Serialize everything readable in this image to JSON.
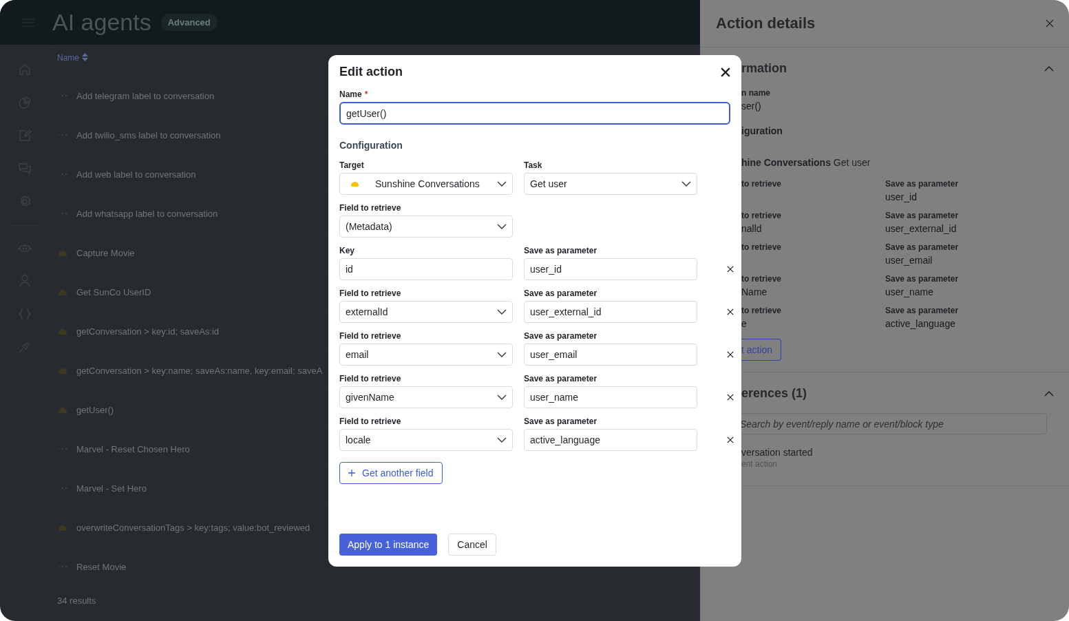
{
  "header": {
    "title": "AI agents",
    "badge": "Advanced"
  },
  "list": {
    "column": "Name",
    "rows": [
      {
        "kind": "dots",
        "name": "Add telegram label to conversation"
      },
      {
        "kind": "dots",
        "name": "Add twilio_sms label to conversation"
      },
      {
        "kind": "dots",
        "name": "Add web label to conversation"
      },
      {
        "kind": "dots",
        "name": "Add whatsapp label to conversation"
      },
      {
        "kind": "blob",
        "name": "Capture Movie"
      },
      {
        "kind": "blob",
        "name": "Get SunCo UserID"
      },
      {
        "kind": "blob",
        "name": "getConversation > key:id; saveAs:id"
      },
      {
        "kind": "blob",
        "name": "getConversation > key:name; saveAs:name, key:email; saveA"
      },
      {
        "kind": "blob",
        "name": "getUser()"
      },
      {
        "kind": "dots",
        "name": "Marvel - Reset Chosen Hero"
      },
      {
        "kind": "dots",
        "name": "Marvel - Set Hero"
      },
      {
        "kind": "blob",
        "name": "overwriteConversationTags > key:tags; value:bot_reviewed"
      },
      {
        "kind": "dots",
        "name": "Reset Movie"
      }
    ],
    "count": "34 results"
  },
  "panel": {
    "title": "Action details",
    "info": {
      "heading": "rmation",
      "name_label": "n name",
      "name_value": "ser()",
      "config_label": "iguration",
      "target": "hine Conversations",
      "task": "Get user",
      "fields": [
        {
          "label": "to retrieve",
          "save_label": "Save as parameter",
          "save_value": "user_id"
        },
        {
          "label": "to retrieve",
          "value": "nalld",
          "save_label": "Save as parameter",
          "save_value": "user_external_id"
        },
        {
          "label": "to retrieve",
          "save_label": "Save as parameter",
          "save_value": "user_email"
        },
        {
          "label": "to retrieve",
          "value": "Name",
          "save_label": "Save as parameter",
          "save_value": "user_name"
        },
        {
          "label": "to retrieve",
          "value": "e",
          "save_label": "Save as parameter",
          "save_value": "active_language"
        }
      ],
      "edit_button": "t action"
    },
    "references": {
      "heading": "erences (1)",
      "search_placeholder": "Search by event/reply name or event/block type",
      "item_title": "versation started",
      "item_subtitle": "ent action"
    }
  },
  "dialog": {
    "title": "Edit action",
    "name_label": "Name",
    "required_mark": "*",
    "name_value": "getUser()",
    "config_heading": "Configuration",
    "target_label": "Target",
    "target_value": "Sunshine Conversations",
    "task_label": "Task",
    "task_value": "Get user",
    "field_label": "Field to retrieve",
    "field_value": "(Metadata)",
    "mappings": [
      {
        "kind": "input",
        "label": "Key",
        "value": "id",
        "save_label": "Save as parameter",
        "save_value": "user_id"
      },
      {
        "kind": "select",
        "label": "Field to retrieve",
        "value": "externalId",
        "save_label": "Save as parameter",
        "save_value": "user_external_id"
      },
      {
        "kind": "select",
        "label": "Field to retrieve",
        "value": "email",
        "save_label": "Save as parameter",
        "save_value": "user_email"
      },
      {
        "kind": "select",
        "label": "Field to retrieve",
        "value": "givenName",
        "save_label": "Save as parameter",
        "save_value": "user_name"
      },
      {
        "kind": "select",
        "label": "Field to retrieve",
        "value": "locale",
        "save_label": "Save as parameter",
        "save_value": "active_language"
      }
    ],
    "add_button": "Get another field",
    "apply_button": "Apply to 1 instance",
    "cancel_button": "Cancel"
  }
}
